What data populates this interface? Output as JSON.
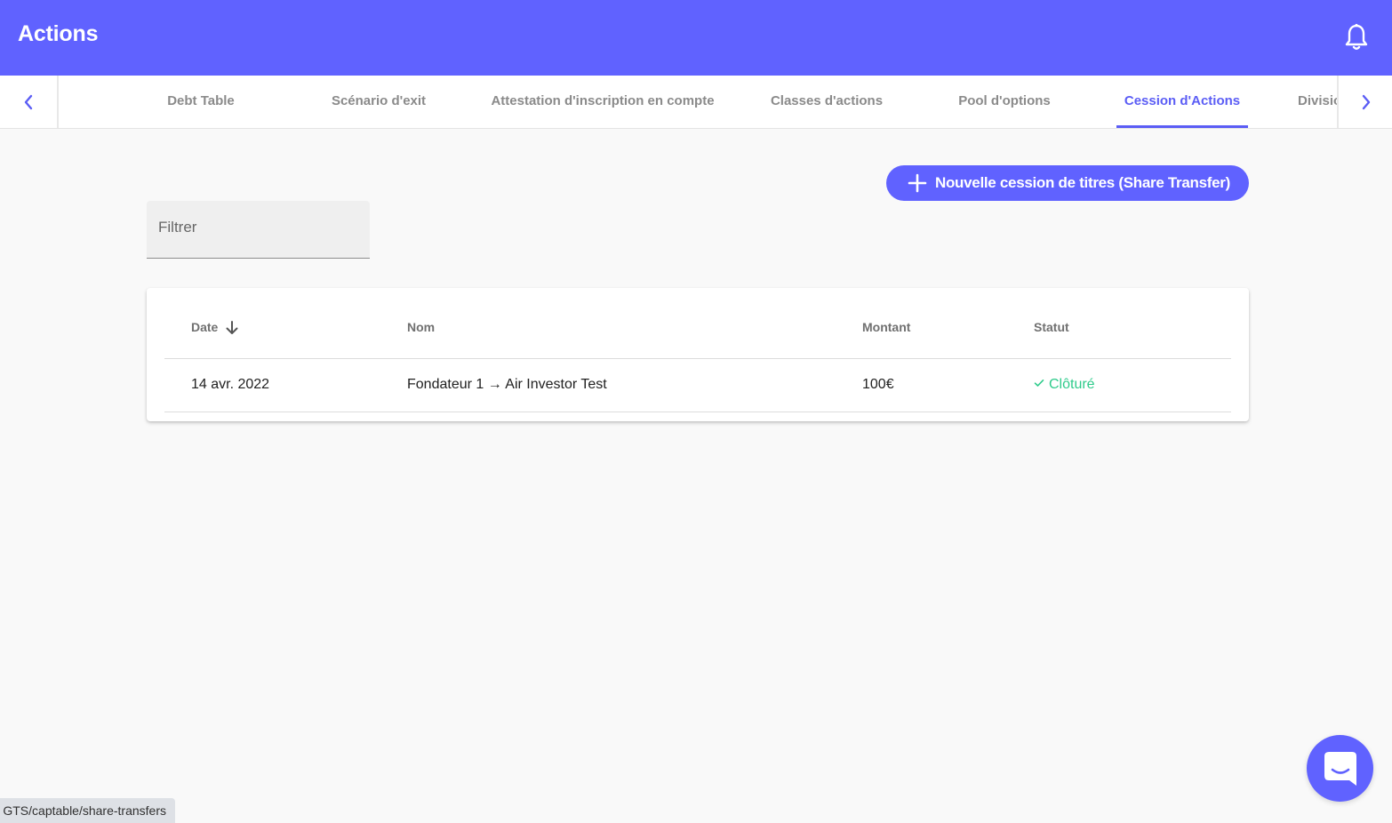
{
  "header": {
    "title": "Actions",
    "notification_icon": "bell-icon"
  },
  "tabs": {
    "prev_icon": "chevron-left-icon",
    "next_icon": "chevron-right-icon",
    "items": [
      {
        "label": "Debt Table"
      },
      {
        "label": "Scénario d'exit"
      },
      {
        "label": "Attestation d'inscription en compte"
      },
      {
        "label": "Classes d'actions"
      },
      {
        "label": "Pool d'options"
      },
      {
        "label": "Cession d'Actions",
        "active": true
      },
      {
        "label": "Division"
      }
    ]
  },
  "toolbar": {
    "new_button_label": "Nouvelle cession de titres (Share Transfer)",
    "new_button_icon": "plus-icon"
  },
  "filter": {
    "placeholder": "Filtrer",
    "value": ""
  },
  "table": {
    "columns": {
      "date": "Date",
      "name": "Nom",
      "amount": "Montant",
      "status": "Statut"
    },
    "sort": {
      "column": "date",
      "direction": "descending",
      "icon": "arrow-down-icon"
    },
    "rows": [
      {
        "date": "14 avr. 2022",
        "name": "Fondateur 1 → Air Investor Test",
        "amount": "100€",
        "status": "Clôturé",
        "status_icon": "check-icon"
      }
    ]
  },
  "status_bar": {
    "url": "GTS/captable/share-transfers"
  },
  "chat": {
    "icon": "chat-bubble-icon"
  },
  "colors": {
    "brand": "#6062ff",
    "active_tab": "#5b5df5",
    "success": "#2ecb8b",
    "background": "#f9f9f9"
  }
}
